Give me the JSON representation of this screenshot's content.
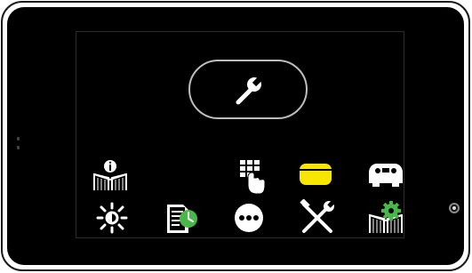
{
  "device": {
    "screen_color": "#000000",
    "frame_color": "#ffffff",
    "icon_color": "#ffffff",
    "accent_color": "#f7e600",
    "clock_color": "#49b848"
  },
  "main_action": {
    "icon": "wrench-icon"
  },
  "grid": {
    "row1": [
      {
        "name": "user-manual",
        "icon": "info-book-icon"
      },
      {
        "name": "keypad",
        "icon": "keypad-touch-icon"
      },
      {
        "name": "yellow-card",
        "icon": "card-reader-icon",
        "active": true
      },
      {
        "name": "scanner",
        "icon": "scanner-icon"
      }
    ],
    "row2": [
      {
        "name": "brightness",
        "icon": "brightness-icon"
      },
      {
        "name": "log",
        "icon": "document-clock-icon"
      },
      {
        "name": "more",
        "icon": "more-icon"
      },
      {
        "name": "tools",
        "icon": "tools-icon"
      },
      {
        "name": "settings",
        "icon": "manual-settings-icon"
      }
    ]
  }
}
